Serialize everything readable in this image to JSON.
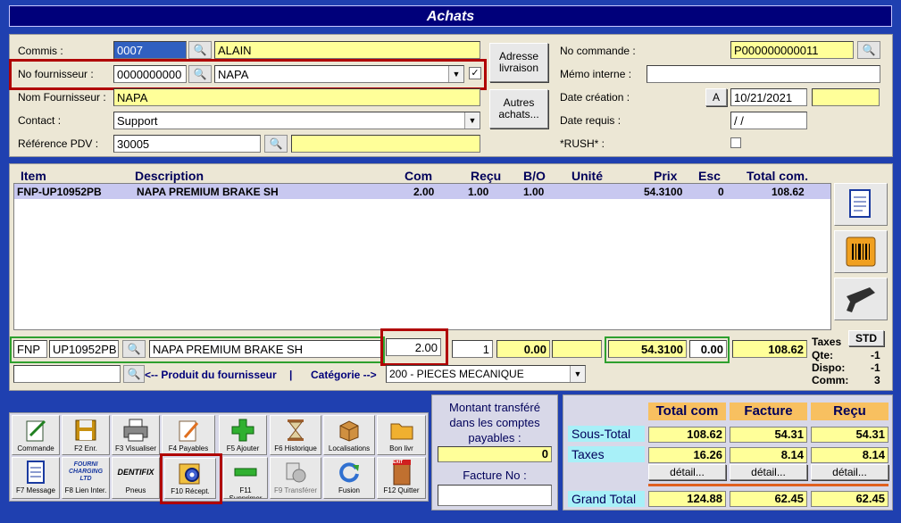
{
  "window": {
    "title": "Achats"
  },
  "header_left": {
    "commis_label": "Commis :",
    "commis_code": "0007",
    "commis_name": "ALAIN",
    "fournisseur_label": "No fournisseur :",
    "fournisseur_code": "0000000000",
    "fournisseur_name": "NAPA",
    "nom_label": "Nom Fournisseur :",
    "nom_value": "NAPA",
    "contact_label": "Contact :",
    "contact_value": "Support",
    "reference_label": "Référence PDV :",
    "reference_value": "30005",
    "adresse_button": "Adresse livraison",
    "autres_button": "Autres achats..."
  },
  "header_right": {
    "commande_label": "No commande :",
    "commande_value": "P000000000011",
    "memo_label": "Mémo interne :",
    "memo_value": "",
    "creation_label": "Date création :",
    "a_button": "A",
    "creation_value": "10/21/2021",
    "requis_label": "Date requis :",
    "requis_value": " / /",
    "rush_label": "*RUSH* :"
  },
  "grid": {
    "columns": [
      "Item",
      "Description",
      "Com",
      "Reçu",
      "B/O",
      "Unité",
      "Prix",
      "Esc",
      "Total com."
    ],
    "rows": [
      {
        "item": "FNP-UP10952PB",
        "description": "NAPA PREMIUM BRAKE SH",
        "com": "2.00",
        "recu": "1.00",
        "bo": "1.00",
        "unite": "",
        "prix": "54.3100",
        "esc": "0",
        "total": "108.62"
      }
    ]
  },
  "edit_row": {
    "prefix": "FNP",
    "part": "UP10952PB",
    "description": "NAPA PREMIUM BRAKE SH",
    "com": "2.00",
    "recu": "1",
    "bo": "0.00",
    "prix": "54.3100",
    "esc": "0.00",
    "total": "108.62",
    "produit_link": "<-- Produit du fournisseur",
    "separator": "|",
    "categorie_label": "Catégorie -->",
    "categorie_value": "200 - PIECES MECANIQUE"
  },
  "taxes_info": {
    "taxes_label": "Taxes",
    "std_button": "STD",
    "qte_label": "Qte:",
    "qte_value": "-1",
    "dispo_label": "Dispo:",
    "dispo_value": "-1",
    "comm_label": "Comm:",
    "comm_value": "3"
  },
  "toolbar": {
    "row1": [
      {
        "label": "Commande",
        "icon": "pen-paper-icon"
      },
      {
        "label": "F2 Enr.",
        "icon": "floppy-icon"
      },
      {
        "label": "F3 Visualiser",
        "icon": "printer-icon"
      },
      {
        "label": "F4 Payables",
        "icon": "pencil-doc-icon"
      },
      {
        "label": "F5 Ajouter",
        "icon": "plus-icon"
      },
      {
        "label": "F6 Historique",
        "icon": "hourglass-icon"
      },
      {
        "label": "Localisations",
        "icon": "box-icon"
      },
      {
        "label": "Bon livr",
        "icon": "folder-icon"
      }
    ],
    "row2": [
      {
        "label": "F7 Message",
        "icon": "notepad-icon"
      },
      {
        "label": "F8 Lien Inter.",
        "icon": "logo-icon",
        "logo": "FOURNI CHARGING LTD"
      },
      {
        "label": "Pneus",
        "icon": "logo-icon",
        "logo": "DENTIFIX"
      },
      {
        "label": "F10 Récept.",
        "icon": "gear-icon"
      },
      {
        "label": "F11 Supprimer",
        "icon": "minus-icon"
      },
      {
        "label": "F9 Transférer",
        "icon": "transfer-icon"
      },
      {
        "label": "Fusion",
        "icon": "refresh-icon"
      },
      {
        "label": "F12 Quitter",
        "icon": "exit-door-icon",
        "exit": "EXIT"
      }
    ]
  },
  "transfer": {
    "title": "Montant transféré dans les comptes payables :",
    "amount": "0",
    "facture_label": "Facture No :",
    "facture_value": ""
  },
  "totals": {
    "headers": [
      "Total com",
      "Facture",
      "Reçu"
    ],
    "sous_total_label": "Sous-Total",
    "sous_total": [
      "108.62",
      "54.31",
      "54.31"
    ],
    "taxes_label": "Taxes",
    "taxes": [
      "16.26",
      "8.14",
      "8.14"
    ],
    "detail_button": "détail...",
    "grand_total_label": "Grand Total",
    "grand_total": [
      "124.88",
      "62.45",
      "62.45"
    ]
  },
  "colors": {
    "title_bg": "#00007a",
    "highlight": "#b00000",
    "green_outline": "#2ea02e",
    "selected_row": "#c8c8f0"
  }
}
